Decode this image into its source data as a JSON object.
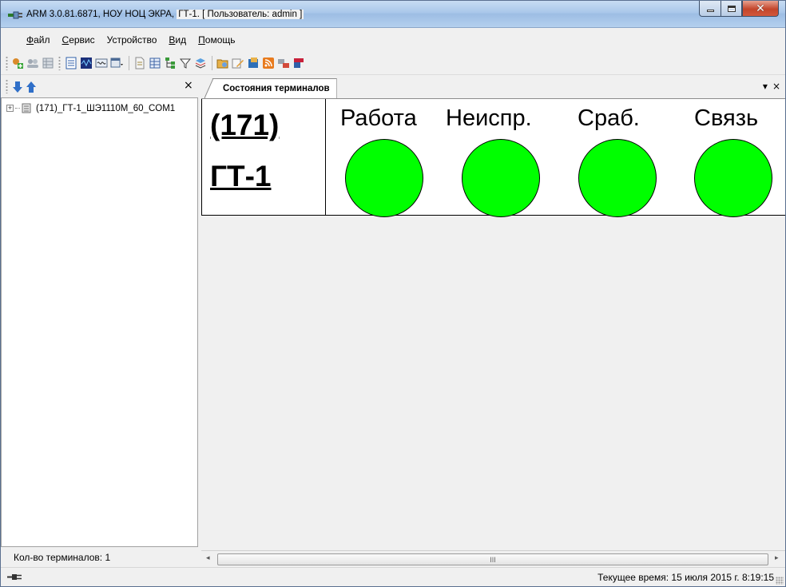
{
  "window": {
    "title_prefix": "ARM 3.0.81.6871, НОУ НОЦ ЭКРА, ",
    "title_highlight": "ГТ-1. [ Пользователь: admin ]",
    "icons": {
      "app": "network-plug-icon",
      "minimize": "minimize-icon",
      "maximize": "maximize-icon",
      "close": "close-icon"
    }
  },
  "menu": [
    {
      "label": "Файл"
    },
    {
      "label": "Сервис"
    },
    {
      "label": "Устройство"
    },
    {
      "label": "Вид"
    },
    {
      "label": "Помощь"
    }
  ],
  "toolbar": {
    "buttons": [
      "add-terminal-icon",
      "users-icon",
      "grid-icon",
      "list-icon",
      "oscillogram-icon",
      "wave-icon",
      "window-dropdown-icon",
      "document-icon",
      "table-icon",
      "tree-structure-icon",
      "filter-icon",
      "layers-icon",
      "folder-open-icon",
      "edit-icon",
      "archive-icon",
      "rss-icon",
      "network-icon",
      "bookmark-icon"
    ]
  },
  "left_panel": {
    "close_glyph": "×",
    "tree_expander": "+",
    "tree_node_label": "(171)_ГТ-1_ШЭ1110М_60_COM1",
    "terminal_count_text": "Кол-во терминалов: 1"
  },
  "doc": {
    "tab_label": "Состояния терминалов",
    "tab_menu_glyph": "▾",
    "tab_close_glyph": "×"
  },
  "terminal": {
    "line1": "(171)",
    "line2": "ГТ-1",
    "indicators": [
      {
        "label": "Работа",
        "color": "#00ff00"
      },
      {
        "label": "Неиспр.",
        "color": "#00ff00"
      },
      {
        "label": "Сраб.",
        "color": "#00ff00"
      },
      {
        "label": "Связь",
        "color": "#00ff00"
      }
    ]
  },
  "scrollbar": {
    "left_arrow": "◂",
    "right_arrow": "▸",
    "thumb_grip": "III"
  },
  "statusbar": {
    "time_text": "Текущее время: 15 июля 2015 г. 8:19:15"
  }
}
